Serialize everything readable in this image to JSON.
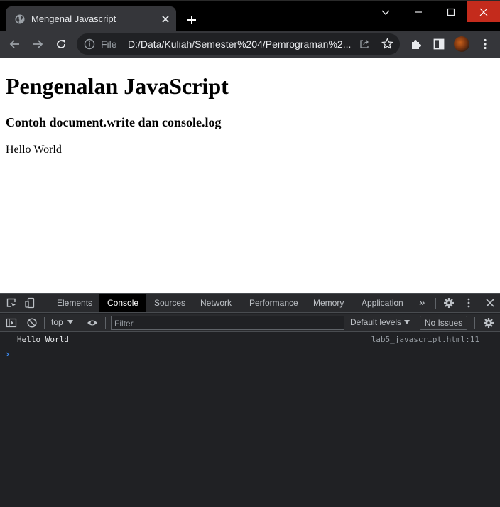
{
  "browser": {
    "tab_title": "Mengenal Javascript",
    "scheme_label": "File",
    "url": "D:/Data/Kuliah/Semester%204/Pemrograman%2..."
  },
  "page": {
    "heading": "Pengenalan JavaScript",
    "subheading": "Contoh document.write dan console.log",
    "body_text": "Hello World"
  },
  "devtools": {
    "tabs": [
      {
        "label": "Elements",
        "active": false
      },
      {
        "label": "Console",
        "active": true
      },
      {
        "label": "Sources",
        "active": false
      },
      {
        "label": "Network",
        "active": false
      },
      {
        "label": "Performance",
        "active": false
      },
      {
        "label": "Memory",
        "active": false
      },
      {
        "label": "Application",
        "active": false
      }
    ],
    "more_tabs": "»",
    "context": "top",
    "filter_placeholder": "Filter",
    "log_levels": "Default levels",
    "issues": "No Issues",
    "messages": [
      {
        "text": "Hello World",
        "source": "lab5_javascript.html:11"
      }
    ],
    "prompt": "›"
  },
  "colors": {
    "titlebar": "#000000",
    "toolbar": "#35363a",
    "close_button": "#c42b1c",
    "devtools_bg": "#202124",
    "prompt": "#3d8ef8"
  }
}
